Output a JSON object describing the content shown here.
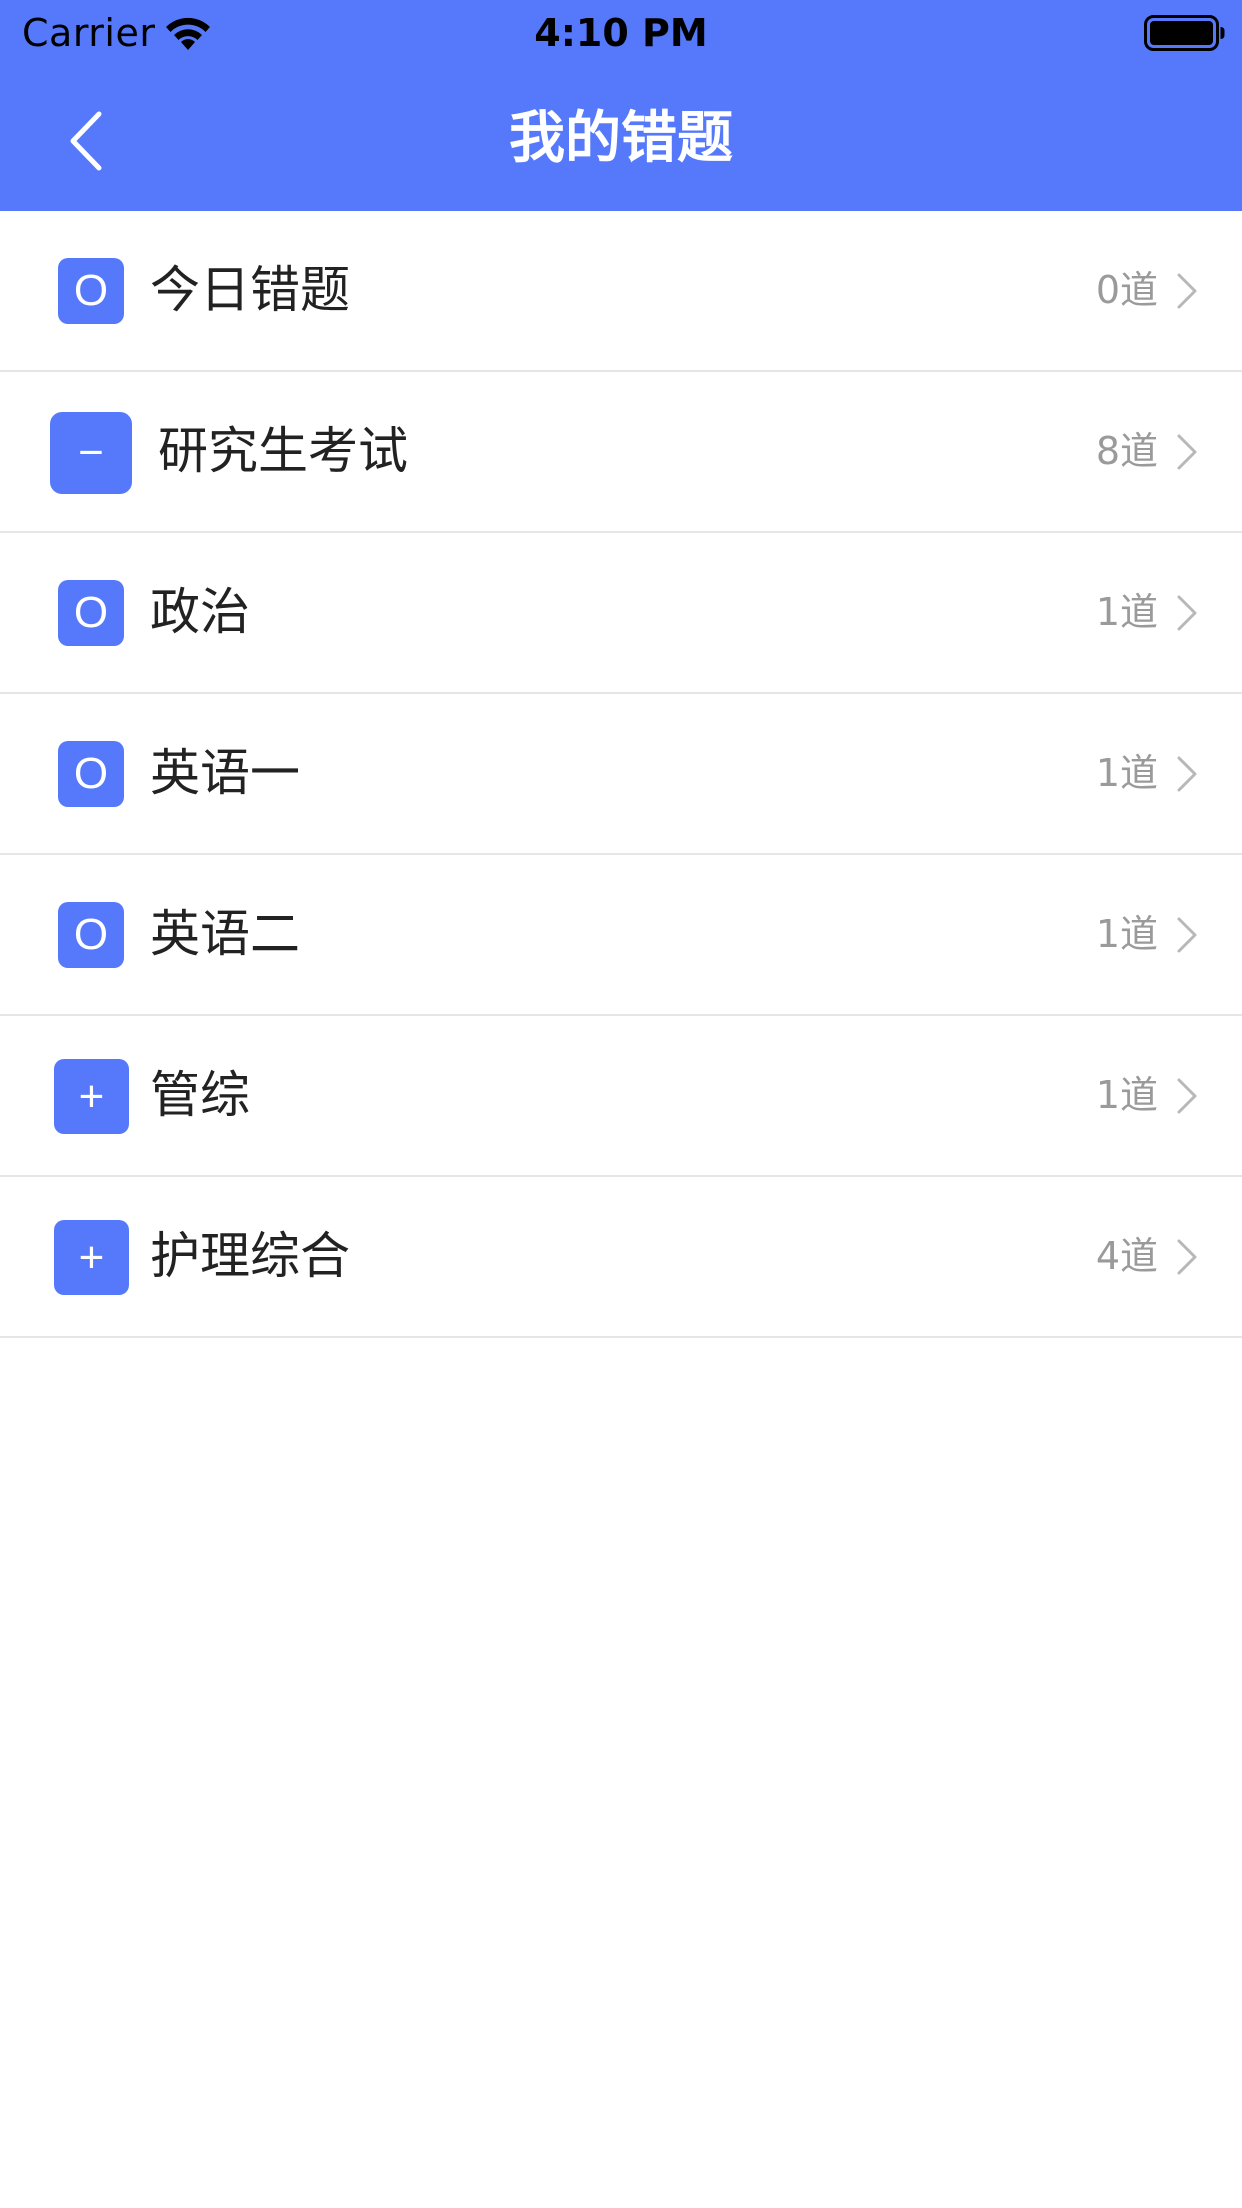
{
  "colors": {
    "accent": "#5579fa",
    "divider": "#e6e6e6",
    "count_text": "#9a9a9a"
  },
  "status_bar": {
    "carrier": "Carrier",
    "time": "4:10 PM",
    "wifi_icon": "wifi-icon",
    "battery_icon": "battery-icon"
  },
  "nav": {
    "back_icon": "chevron-left-icon",
    "title": "我的错题"
  },
  "list": {
    "items": [
      {
        "label": "今日错题",
        "count": "0道",
        "icon": "o",
        "glyph": "O",
        "chevron": "chevron-right-icon"
      },
      {
        "label": "研究生考试",
        "count": "8道",
        "icon": "minus",
        "glyph": "−",
        "chevron": "chevron-right-icon"
      },
      {
        "label": "政治",
        "count": "1道",
        "icon": "o",
        "glyph": "O",
        "chevron": "chevron-right-icon"
      },
      {
        "label": "英语一",
        "count": "1道",
        "icon": "o",
        "glyph": "O",
        "chevron": "chevron-right-icon"
      },
      {
        "label": "英语二",
        "count": "1道",
        "icon": "o",
        "glyph": "O",
        "chevron": "chevron-right-icon"
      },
      {
        "label": "管综",
        "count": "1道",
        "icon": "plus",
        "glyph": "+",
        "chevron": "chevron-right-icon"
      },
      {
        "label": "护理综合",
        "count": "4道",
        "icon": "plus",
        "glyph": "+",
        "chevron": "chevron-right-icon"
      }
    ]
  }
}
